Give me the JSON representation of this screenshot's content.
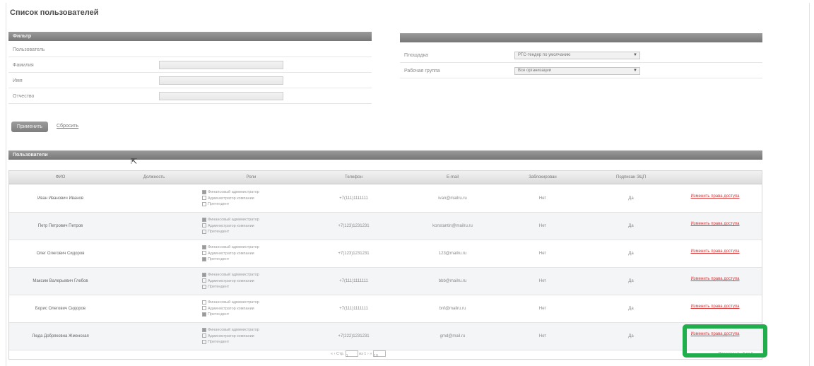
{
  "page": {
    "title": "Список пользователей"
  },
  "filter": {
    "header": "Фильтр",
    "section_label": "Пользователь",
    "fields": [
      {
        "label": "Фамилия",
        "value": ""
      },
      {
        "label": "Имя",
        "value": ""
      },
      {
        "label": "Отчество",
        "value": ""
      }
    ],
    "right_fields": [
      {
        "label": "Площадка",
        "value": "РТС-тендер по умолчанию"
      },
      {
        "label": "Рабочая группа",
        "value": "Все организации"
      }
    ],
    "apply_label": "Применить",
    "reset_label": "Сбросить"
  },
  "users": {
    "header": "Пользователи",
    "columns": [
      "ФИО",
      "Должность",
      "Роли",
      "Телефон",
      "E-mail",
      "Заблокирован",
      "Подписан ЭЦП",
      ""
    ],
    "role_labels": [
      "Финансовый администратор",
      "Администратор компании",
      "Претендент"
    ],
    "rows": [
      {
        "name": "Иван Иванович Иванов",
        "position": "",
        "roles": [
          true,
          false,
          false
        ],
        "phone": "+7(111)1111111",
        "email": "ivan@mailru.ru",
        "blocked": "Нет",
        "signed": "Да",
        "action": "Изменить права доступа"
      },
      {
        "name": "Петр Петрович Петров",
        "position": "",
        "roles": [
          true,
          false,
          false
        ],
        "phone": "+7(123)1231231",
        "email": "konstantin@mailru.ru",
        "blocked": "Нет",
        "signed": "Да",
        "action": "Изменить права доступа"
      },
      {
        "name": "Олег Олегович Сидоров",
        "position": "",
        "roles": [
          true,
          false,
          true
        ],
        "phone": "+7(123)1231231",
        "email": "123@mailru.ru",
        "blocked": "Нет",
        "signed": "Да",
        "action": "Изменить права доступа"
      },
      {
        "name": "Максим Валерьевич Глебов",
        "position": "",
        "roles": [
          true,
          false,
          false
        ],
        "phone": "+7(111)1111111",
        "email": "bbb@mailru.ru",
        "blocked": "Нет",
        "signed": "Да",
        "action": "Изменить права доступа"
      },
      {
        "name": "Борис Олегович Сидоров",
        "position": "",
        "roles": [
          false,
          false,
          true
        ],
        "phone": "+7(111)1111111",
        "email": "bnf@mailru.ru",
        "blocked": "Нет",
        "signed": "Да",
        "action": "Изменить права доступа"
      },
      {
        "name": "Люда Добряковна Жменская",
        "position": "",
        "roles": [
          true,
          false,
          false
        ],
        "phone": "+7(222)1231231",
        "email": "gmd@mail.ru",
        "blocked": "Нет",
        "signed": "Да",
        "action": "Изменить права доступа"
      }
    ],
    "pager": {
      "page_label": "Стр.",
      "page_value": "1",
      "of_label": "из 1",
      "page_size": "10",
      "info": "Показаны 1 - 6 из 6"
    }
  },
  "colors": {
    "highlight": "#1fae4b",
    "link": "#d43a3a",
    "header_bar": "#767676"
  }
}
